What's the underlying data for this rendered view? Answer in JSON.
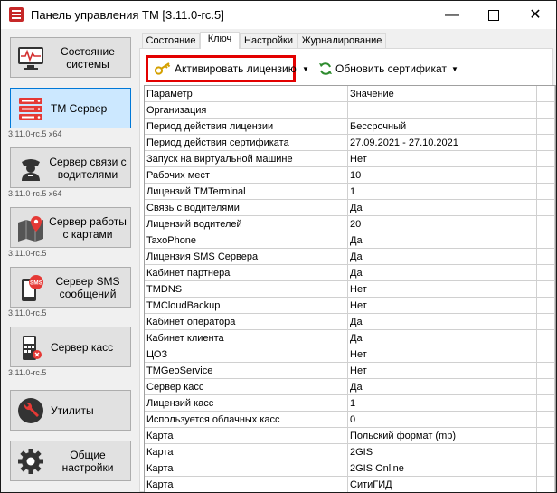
{
  "window": {
    "title": "Панель управления ТМ [3.11.0-rc.5]",
    "min_symbol": "—",
    "close_symbol": "✕"
  },
  "sidebar": {
    "items": [
      {
        "label": "Состояние системы",
        "icon": "monitor-pulse-icon",
        "version": ""
      },
      {
        "label": "ТМ Сервер",
        "icon": "server-icon",
        "version": "3.11.0-rc.5 x64"
      },
      {
        "label": "Сервер связи с водителями",
        "icon": "driver-icon",
        "version": "3.11.0-rc.5 x64"
      },
      {
        "label": "Сервер работы с картами",
        "icon": "map-pin-icon",
        "version": "3.11.0-rc.5"
      },
      {
        "label": "Сервер SMS сообщений",
        "icon": "sms-phone-icon",
        "version": "3.11.0-rc.5"
      },
      {
        "label": "Сервер касс",
        "icon": "cash-register-icon",
        "version": "3.11.0-rc.5"
      },
      {
        "label": "Утилиты",
        "icon": "wrench-icon",
        "version": ""
      },
      {
        "label": "Общие настройки",
        "icon": "gear-icon",
        "version": ""
      }
    ],
    "active_index": 1
  },
  "tabs": [
    "Состояние",
    "Ключ",
    "Настройки",
    "Журналирование"
  ],
  "active_tab": 1,
  "toolbar": {
    "activate_label": "Активировать лицензию",
    "renew_label": "Обновить сертификат"
  },
  "table": {
    "headers": [
      "Параметр",
      "Значение"
    ],
    "rows": [
      [
        "Организация",
        ""
      ],
      [
        "Период действия лицензии",
        "Бессрочный"
      ],
      [
        "Период действия сертификата",
        "27.09.2021 - 27.10.2021"
      ],
      [
        "Запуск на виртуальной машине",
        "Нет"
      ],
      [
        "Рабочих мест",
        "10"
      ],
      [
        "Лицензий TMTerminal",
        "1"
      ],
      [
        "Связь с водителями",
        "Да"
      ],
      [
        "Лицензий водителей",
        "20"
      ],
      [
        "TaxoPhone",
        "Да"
      ],
      [
        "Лицензия SMS Сервера",
        "Да"
      ],
      [
        "Кабинет партнера",
        "Да"
      ],
      [
        "TMDNS",
        "Нет"
      ],
      [
        "TMCloudBackup",
        "Нет"
      ],
      [
        "Кабинет оператора",
        "Да"
      ],
      [
        "Кабинет клиента",
        "Да"
      ],
      [
        "ЦОЗ",
        "Нет"
      ],
      [
        "TMGeoService",
        "Нет"
      ],
      [
        "Сервер касс",
        "Да"
      ],
      [
        "Лицензий касс",
        "1"
      ],
      [
        "Используется облачных касс",
        "0"
      ],
      [
        "Карта",
        "Польский формат (mp)"
      ],
      [
        "Карта",
        "2GIS"
      ],
      [
        "Карта",
        "2GIS Online"
      ],
      [
        "Карта",
        "СитиГИД"
      ]
    ]
  }
}
